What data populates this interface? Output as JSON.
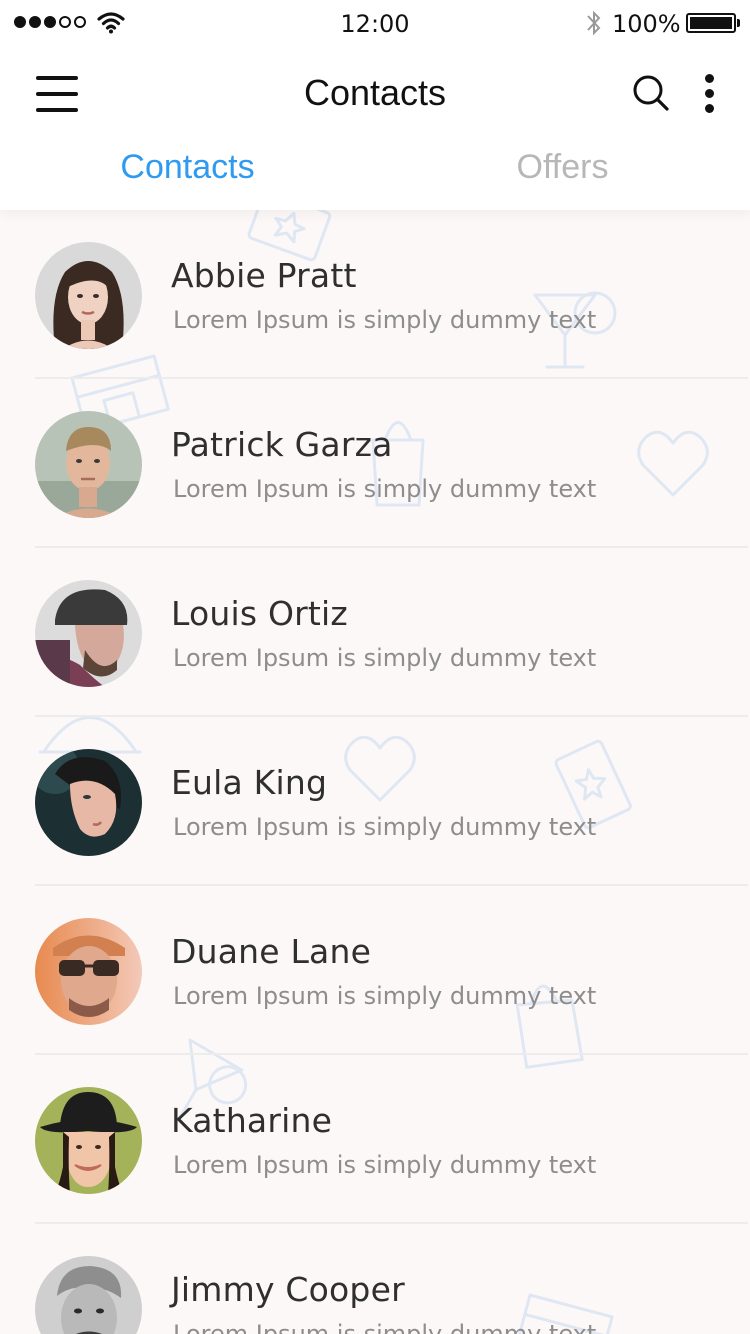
{
  "status_bar": {
    "signal_icon": "signal-dots-icon",
    "wifi_icon": "wifi-icon",
    "time": "12:00",
    "bluetooth_icon": "bluetooth-icon",
    "battery_percent": "100%",
    "battery_level": 1.0
  },
  "header": {
    "menu_icon": "hamburger-menu-icon",
    "title": "Contacts",
    "search_icon": "search-icon",
    "more_icon": "more-vertical-icon"
  },
  "tabs": [
    {
      "label": "Contacts",
      "active": true
    },
    {
      "label": "Offers",
      "active": false
    }
  ],
  "colors": {
    "accent": "#2e9af0",
    "inactive_tab": "#b7b7b7",
    "background": "#fdf8f8",
    "doodle": "#dfe7f3"
  },
  "contacts": [
    {
      "name": "Abbie Pratt",
      "subtitle": "Lorem Ipsum is simply dummy text",
      "avatar": "female-portrait-avatar"
    },
    {
      "name": "Patrick Garza",
      "subtitle": "Lorem Ipsum is simply dummy text",
      "avatar": "male-portrait-avatar"
    },
    {
      "name": "Louis Ortiz",
      "subtitle": "Lorem Ipsum is simply dummy text",
      "avatar": "bearded-man-beanie-avatar"
    },
    {
      "name": "Eula King",
      "subtitle": "Lorem Ipsum is simply dummy text",
      "avatar": "female-profile-avatar"
    },
    {
      "name": "Duane Lane",
      "subtitle": "Lorem Ipsum is simply dummy text",
      "avatar": "man-sunglasses-cap-avatar"
    },
    {
      "name": "Katharine",
      "subtitle": "Lorem Ipsum is simply dummy text",
      "avatar": "woman-hat-avatar"
    },
    {
      "name": "Jimmy Cooper",
      "subtitle": "Lorem Ipsum is simply dummy text",
      "avatar": "older-man-avatar"
    }
  ]
}
